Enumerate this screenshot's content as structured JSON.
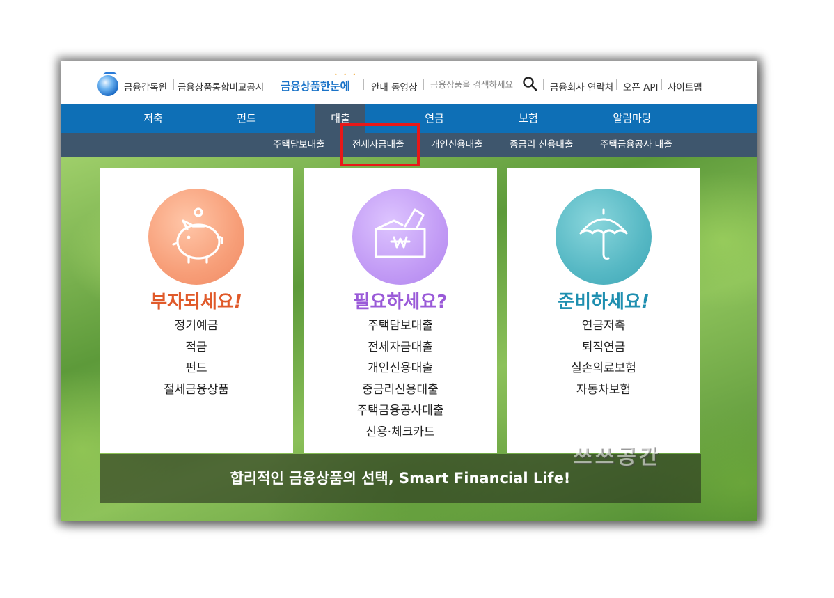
{
  "header": {
    "fss_label": "금융감독원",
    "portal_label": "금융상품통합비교공시",
    "brand": "금융상품한눈에",
    "guide_video": "안내 동영상",
    "search_placeholder": "금융상품을 검색하세요",
    "contacts": "금융회사 연락처",
    "open_api": "오픈 API",
    "sitemap": "사이트맵"
  },
  "nav": {
    "items": [
      "저축",
      "펀드",
      "대출",
      "연금",
      "보험",
      "알림마당"
    ],
    "active": "대출"
  },
  "subnav": {
    "items": [
      "주택담보대출",
      "전세자금대출",
      "개인신용대출",
      "중금리 신용대출",
      "주택금융공사 대출"
    ],
    "highlighted": "전세자금대출",
    "highlight_color": "#e81818"
  },
  "cards": [
    {
      "title": "부자되세요",
      "mark": "!",
      "color": "#e05a2a",
      "icon": "piggy-bank-icon",
      "items": [
        "정기예금",
        "적금",
        "펀드",
        "절세금융상품"
      ]
    },
    {
      "title": "필요하세요",
      "mark": "?",
      "color": "#9a5ad8",
      "icon": "envelope-won-icon",
      "items": [
        "주택담보대출",
        "전세자금대출",
        "개인신용대출",
        "중금리신용대출",
        "주택금융공사대출",
        "신용·체크카드"
      ]
    },
    {
      "title": "준비하세요",
      "mark": "!",
      "color": "#1f8fb0",
      "icon": "umbrella-icon",
      "items": [
        "연금저축",
        "퇴직연금",
        "실손의료보험",
        "자동차보험"
      ]
    }
  ],
  "banner": "합리적인 금융상품의 선택, Smart Financial Life!",
  "watermark": "쓰쓰공간",
  "colors": {
    "nav_blue": "#0e6fb6",
    "subnav_dark": "#3e566d",
    "brand_blue": "#1a73c8"
  }
}
